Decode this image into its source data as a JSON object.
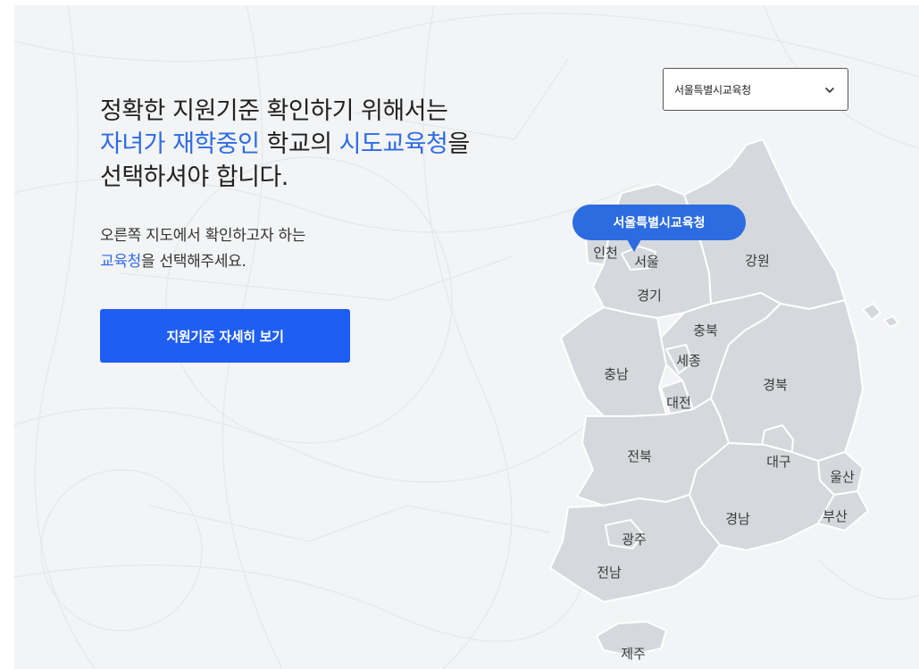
{
  "headline": {
    "line1": "정확한 지원기준 확인하기 위해서는",
    "line2_hl1": "자녀가 재학중인",
    "line2_mid": " 학교의 ",
    "line2_hl2": "시도교육청",
    "line2_end": "을",
    "line3": "선택하셔야 합니다."
  },
  "subtext": {
    "line1": "오른쪽 지도에서 확인하고자 하는",
    "line2_hl": "교육청",
    "line2_rest": "을 선택해주세요."
  },
  "cta_label": "지원기준 자세히 보기",
  "select": {
    "value": "서울특별시교육청",
    "icon": "chevron-down-icon"
  },
  "map": {
    "tooltip": "서울특별시교육청",
    "regions": {
      "incheon": "인천",
      "seoul": "서울",
      "gangwon": "강원",
      "gyeonggi": "경기",
      "chungbuk": "충북",
      "sejong": "세종",
      "chungnam": "충남",
      "daejeon": "대전",
      "gyeongbuk": "경북",
      "jeonbuk": "전북",
      "daegu": "대구",
      "ulsan": "울산",
      "busan": "부산",
      "gyeongnam": "경남",
      "gwangju": "광주",
      "jeonnam": "전남",
      "jeju": "제주"
    }
  },
  "colors": {
    "accent": "#2d6be6",
    "button": "#1e5ef3",
    "tooltip": "#2c6ce0",
    "land": "#d5d8dc",
    "background": "#f3f4f5"
  }
}
